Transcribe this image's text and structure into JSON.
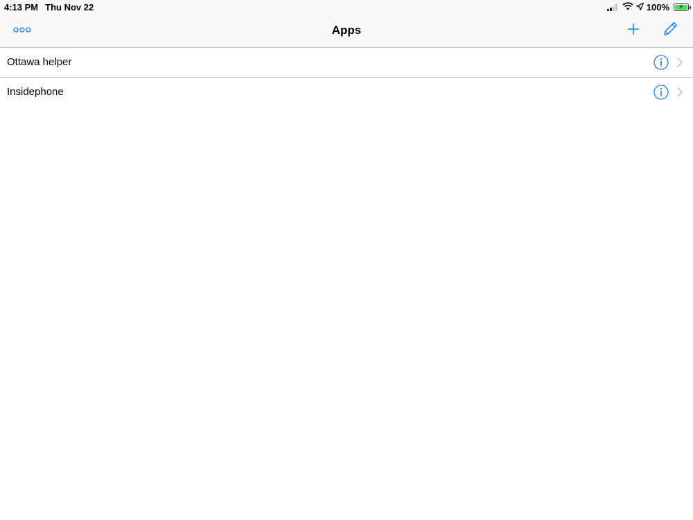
{
  "status_bar": {
    "time": "4:13 PM",
    "date": "Thu Nov 22",
    "battery_text": "100%",
    "battery_level": 1.0,
    "icons": [
      "signal-icon",
      "wifi-icon",
      "location-icon",
      "battery-icon"
    ]
  },
  "nav": {
    "title": "Apps",
    "more_icon": "more-icon",
    "add_icon": "plus-icon",
    "edit_icon": "pencil-icon"
  },
  "list": {
    "items": [
      {
        "label": "Ottawa helper"
      },
      {
        "label": "Insidephone"
      }
    ]
  },
  "colors": {
    "accent": "#1b7ef3",
    "separator": "#c8c7cc",
    "bar_background": "#f7f7f7",
    "chevron": "#c7c7cc",
    "battery": "#4cd964"
  }
}
